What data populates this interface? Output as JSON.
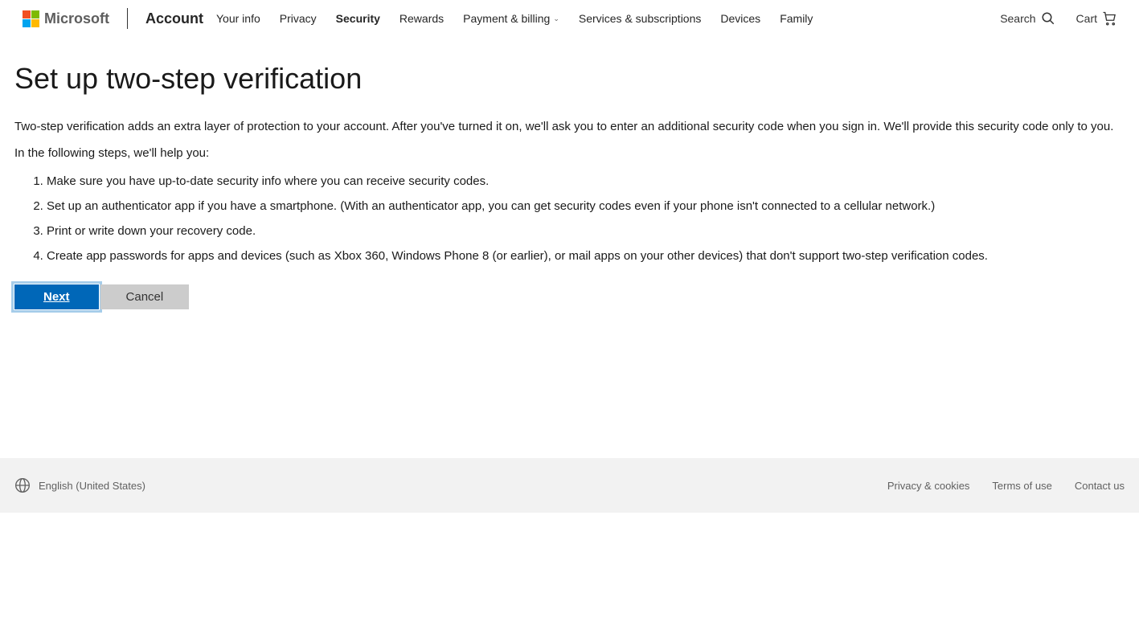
{
  "header": {
    "brand": "Microsoft",
    "section": "Account",
    "nav": [
      {
        "label": "Your info"
      },
      {
        "label": "Privacy"
      },
      {
        "label": "Security",
        "active": true
      },
      {
        "label": "Rewards"
      },
      {
        "label": "Payment & billing",
        "dropdown": true
      },
      {
        "label": "Services & subscriptions"
      },
      {
        "label": "Devices"
      },
      {
        "label": "Family"
      }
    ],
    "search": "Search",
    "cart": "Cart"
  },
  "page": {
    "title": "Set up two-step verification",
    "intro": "Two-step verification adds an extra layer of protection to your account. After you've turned it on, we'll ask you to enter an additional security code when you sign in. We'll provide this security code only to you.",
    "subintro": "In the following steps, we'll help you:",
    "steps": [
      "Make sure you have up-to-date security info where you can receive security codes.",
      "Set up an authenticator app if you have a smartphone. (With an authenticator app, you can get security codes even if your phone isn't connected to a cellular network.)",
      "Print or write down your recovery code.",
      "Create app passwords for apps and devices (such as Xbox 360, Windows Phone 8 (or earlier), or mail apps on your other devices) that don't support two-step verification codes."
    ],
    "next_label": "Next",
    "cancel_label": "Cancel"
  },
  "footer": {
    "language": "English (United States)",
    "links": [
      "Privacy & cookies",
      "Terms of use",
      "Contact us"
    ]
  }
}
